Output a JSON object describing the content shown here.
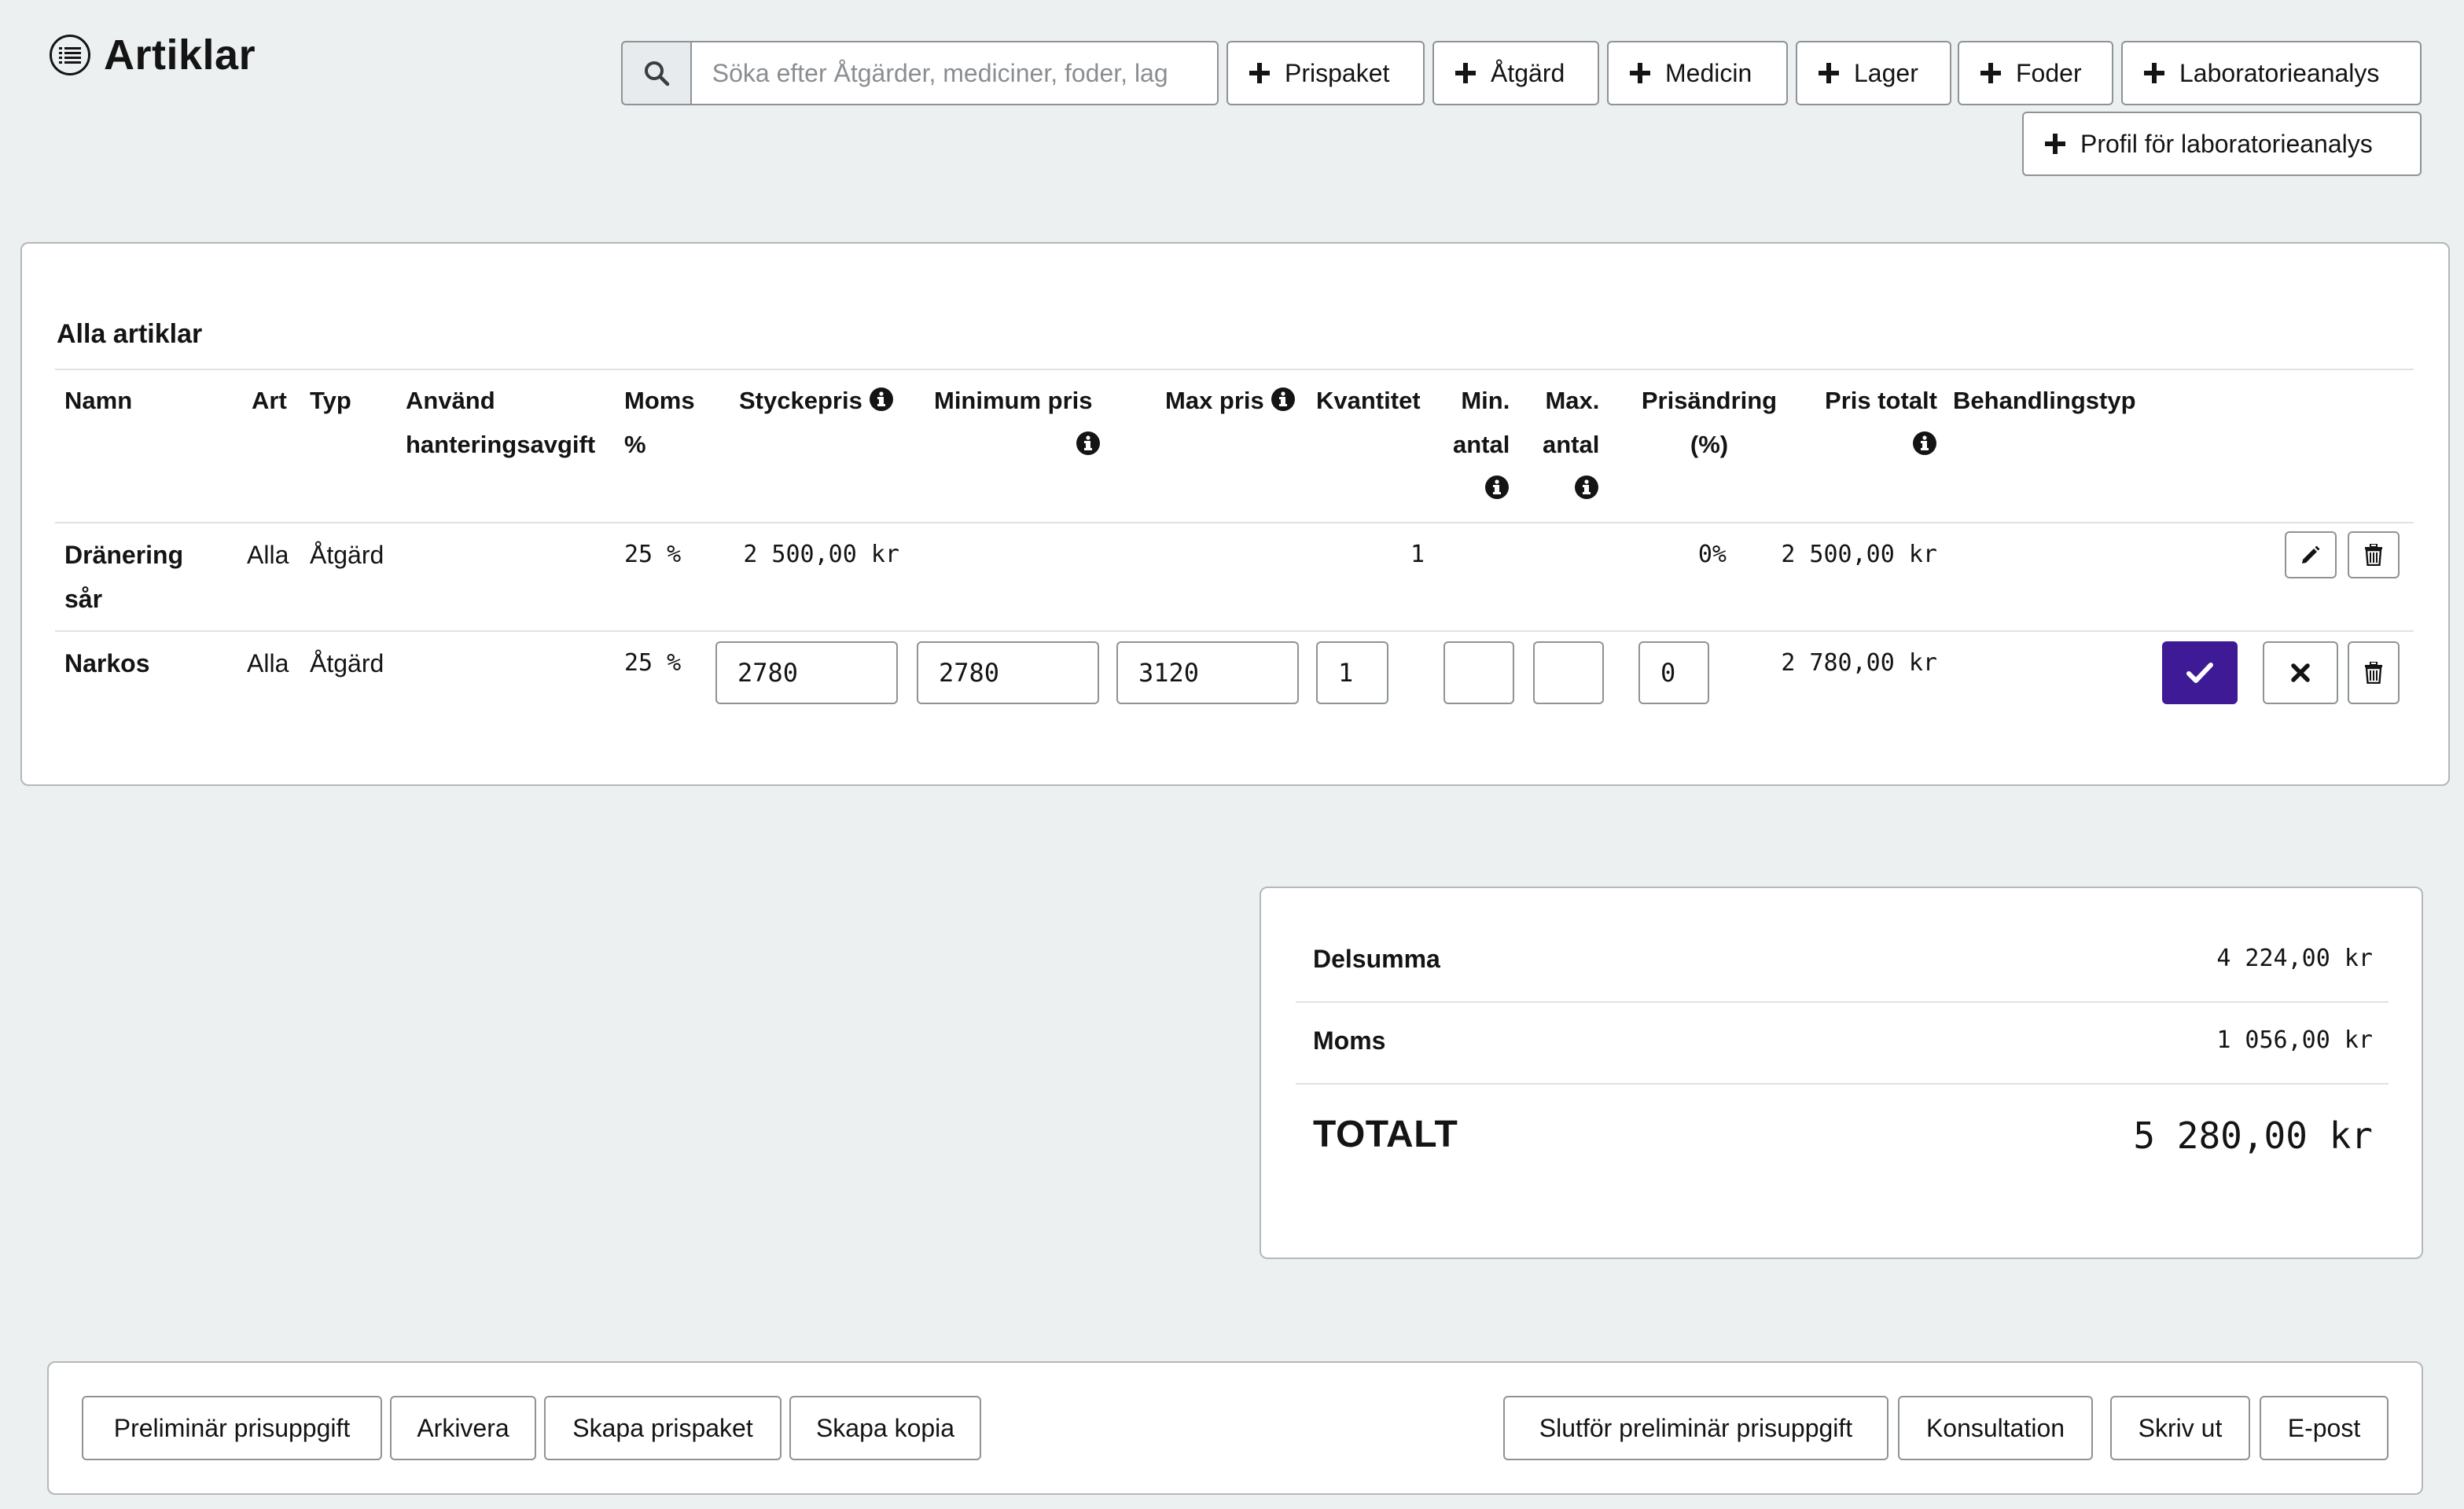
{
  "header": {
    "title": "Artiklar",
    "search_placeholder": "Söka efter Åtgärder, mediciner, foder, lag",
    "buttons": {
      "prispaket": "Prispaket",
      "atgard": "Åtgärd",
      "medicin": "Medicin",
      "lager": "Lager",
      "foder": "Foder",
      "laboratorieanalys": "Laboratorieanalys",
      "profil": "Profil för laboratorieanalys"
    }
  },
  "items": {
    "section_title": "Alla artiklar",
    "columns": {
      "namn": "Namn",
      "art": "Art",
      "typ": "Typ",
      "anvand_1": "Använd",
      "anvand_2": "hanteringsavgift",
      "moms_1": "Moms",
      "moms_2": "%",
      "styckepris": "Styckepris",
      "minimum_pris": "Minimum pris",
      "max_pris": "Max pris",
      "kvantitet": "Kvantitet",
      "min_antal_1": "Min.",
      "min_antal_2": "antal",
      "max_antal_1": "Max.",
      "max_antal_2": "antal",
      "prisandring_1": "Prisändring",
      "prisandring_2": "(%)",
      "pris_totalt": "Pris totalt",
      "behandlingstyp": "Behandlingstyp"
    },
    "rows": [
      {
        "name_1": "Dränering",
        "name_2": "sår",
        "art": "Alla",
        "typ": "Åtgärd",
        "moms": "25 %",
        "styckepris": "2 500,00 kr",
        "kvantitet": "1",
        "prisandring": "0%",
        "pris_totalt": "2 500,00 kr"
      },
      {
        "name": "Narkos",
        "art": "Alla",
        "typ": "Åtgärd",
        "moms": "25 %",
        "styckepris": "2780",
        "minimum_pris": "2780",
        "max_pris": "3120",
        "kvantitet": "1",
        "min_antal": "",
        "max_antal": "",
        "prisandring": "0",
        "pris_totalt": "2 780,00 kr"
      }
    ]
  },
  "totals": {
    "delsumma_label": "Delsumma",
    "delsumma_value": "4 224,00 kr",
    "moms_label": "Moms",
    "moms_value": "1 056,00 kr",
    "totalt_label": "TOTALT",
    "totalt_value": "5 280,00 kr"
  },
  "footer": {
    "preliminar": "Preliminär prisuppgift",
    "arkivera": "Arkivera",
    "skapa_prispaket": "Skapa prispaket",
    "skapa_kopia": "Skapa kopia",
    "slutfor": "Slutför preliminär prisuppgift",
    "konsultation": "Konsultation",
    "skriv_ut": "Skriv ut",
    "epost": "E-post"
  },
  "colors": {
    "background": "#edf0f1",
    "primary": "#3e1a96",
    "border": "#8e9396"
  }
}
